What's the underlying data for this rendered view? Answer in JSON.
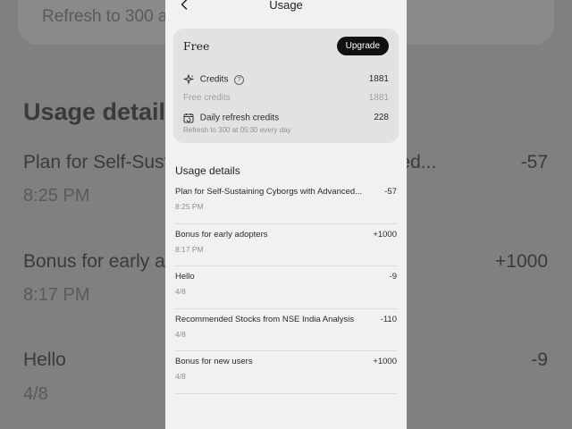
{
  "background": {
    "card_text": "Refresh to 300 at 05:30 every day",
    "heading": "Usage details",
    "rows": [
      {
        "title": "Plan for Self-Sustaining Cyborgs with Advanced...",
        "amount": "-57",
        "time": "8:25 PM"
      },
      {
        "title": "Bonus for early adopters",
        "amount": "+1000",
        "time": "8:17 PM"
      },
      {
        "title": "Hello",
        "amount": "-9",
        "time": "4/8"
      }
    ]
  },
  "nav": {
    "back_icon": "chevron-left-icon",
    "title": "Usage"
  },
  "plan": {
    "name": "Free",
    "upgrade_label": "Upgrade",
    "credits_label": "Credits",
    "credits_value": "1881",
    "free_credits_label": "Free credits",
    "free_credits_value": "1881",
    "daily_refresh_label": "Daily refresh credits",
    "daily_refresh_value": "228",
    "refresh_note": "Refresh to 300 at 05:30 every day"
  },
  "usage": {
    "title": "Usage details",
    "items": [
      {
        "title": "Plan for Self-Sustaining Cyborgs with Advanced...",
        "amount": "-57",
        "time": "8:25 PM"
      },
      {
        "title": "Bonus for early adopters",
        "amount": "+1000",
        "time": "8:17 PM"
      },
      {
        "title": "Hello",
        "amount": "-9",
        "time": "4/8"
      },
      {
        "title": "Recommended Stocks from NSE India Analysis",
        "amount": "-110",
        "time": "4/8"
      },
      {
        "title": "Bonus for new users",
        "amount": "+1000",
        "time": "4/8"
      }
    ]
  }
}
